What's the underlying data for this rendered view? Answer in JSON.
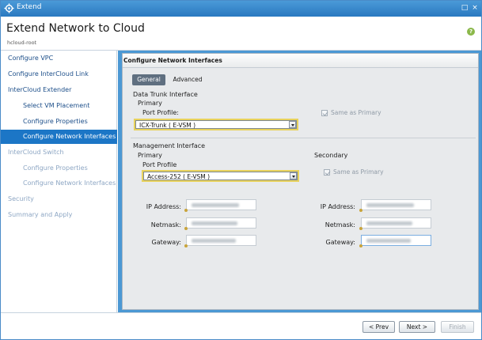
{
  "window": {
    "title": "Extend",
    "buttons": {
      "restore": "□",
      "close": "×"
    }
  },
  "header": {
    "title": "Extend Network to Cloud",
    "subtitle": "hcloud-root",
    "help": "?"
  },
  "sidebar": {
    "items": [
      {
        "label": "Configure VPC",
        "state": "normal",
        "level": "top"
      },
      {
        "label": "Configure InterCloud Link",
        "state": "normal",
        "level": "top"
      },
      {
        "label": "InterCloud Extender",
        "state": "normal",
        "level": "top"
      },
      {
        "label": "Select VM Placement",
        "state": "normal",
        "level": "sub"
      },
      {
        "label": "Configure Properties",
        "state": "normal",
        "level": "sub"
      },
      {
        "label": "Configure Network Interfaces",
        "state": "active",
        "level": "sub"
      },
      {
        "label": "InterCloud Switch",
        "state": "disabled",
        "level": "top"
      },
      {
        "label": "Configure Properties",
        "state": "disabled",
        "level": "sub"
      },
      {
        "label": "Configure Network Interfaces",
        "state": "disabled",
        "level": "sub"
      },
      {
        "label": "Security",
        "state": "disabled",
        "level": "top"
      },
      {
        "label": "Summary and Apply",
        "state": "disabled",
        "level": "top"
      }
    ]
  },
  "panel": {
    "title": "Configure Network Interfaces",
    "tabs": [
      {
        "label": "General",
        "active": true
      },
      {
        "label": "Advanced",
        "active": false
      }
    ],
    "data_trunk": {
      "heading": "Data Trunk Interface",
      "primary_label": "Primary",
      "port_profile_label": "Port Profile:",
      "port_profile_value": "ICX-Trunk ( E-VSM )",
      "same_as_primary": "Same as Primary"
    },
    "management": {
      "heading": "Management Interface",
      "primary_label": "Primary",
      "port_profile_label": "Port Profile",
      "port_profile_value": "Access-252 ( E-VSM )",
      "secondary_label": "Secondary",
      "same_as_primary": "Same as Primary",
      "ip_label": "IP Address:",
      "netmask_label": "Netmask:",
      "gateway_label": "Gateway:"
    }
  },
  "footer": {
    "prev": "< Prev",
    "next": "Next >",
    "finish": "Finish"
  },
  "colors": {
    "accent": "#1c76c6",
    "titlebar": "#2a79c0",
    "highlight_border": "#e8d25c"
  }
}
